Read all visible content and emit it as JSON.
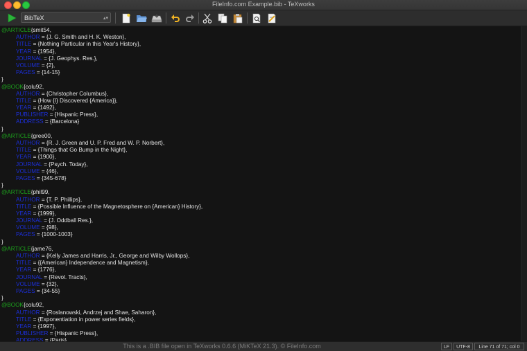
{
  "window": {
    "title": "FileInfo.com Example.bib - TeXworks"
  },
  "toolbar": {
    "engine": "BibTeX"
  },
  "statusbar": {
    "caption": "This is a .BIB file open in TeXworks 0.6.6 (MiKTeX 21.3). © FileInfo.com",
    "line_ending": "LF",
    "encoding": "UTF-8",
    "position": "Line 71 of 71; col 0"
  },
  "editor": {
    "lines": [
      {
        "t": "entry",
        "type": "@ARTICLE",
        "rest": "{smit54,"
      },
      {
        "t": "field",
        "key": "AUTHOR",
        "val": " = {J. G. Smith and H. K. Weston},"
      },
      {
        "t": "field",
        "key": "TITLE",
        "val": " = {Nothing Particular in this Year's History},"
      },
      {
        "t": "field",
        "key": "YEAR",
        "val": " = {1954},"
      },
      {
        "t": "field",
        "key": "JOURNAL",
        "val": " = {J. Geophys. Res.},"
      },
      {
        "t": "field",
        "key": "VOLUME",
        "val": " = {2},"
      },
      {
        "t": "field",
        "key": "PAGES",
        "val": " = {14-15}"
      },
      {
        "t": "close",
        "text": "}"
      },
      {
        "t": "entry",
        "type": "@BOOK",
        "rest": "{colu92,"
      },
      {
        "t": "field",
        "key": "AUTHOR",
        "val": " = {Christopher Columbus},"
      },
      {
        "t": "field",
        "key": "TITLE",
        "val": " = {How {I} Discovered {America}},"
      },
      {
        "t": "field",
        "key": "YEAR",
        "val": " = {1492},"
      },
      {
        "t": "field",
        "key": "PUBLISHER",
        "val": " = {Hispanic Press},"
      },
      {
        "t": "field",
        "key": "ADDRESS",
        "val": " = {Barcelona}"
      },
      {
        "t": "close",
        "text": "}"
      },
      {
        "t": "entry",
        "type": "@ARTICLE",
        "rest": "{gree00,"
      },
      {
        "t": "field",
        "key": "AUTHOR",
        "val": " = {R. J. Green and U. P. Fred and W. P. Norbert},"
      },
      {
        "t": "field",
        "key": "TITLE",
        "val": " = {Things that Go Bump in the Night},"
      },
      {
        "t": "field",
        "key": "YEAR",
        "val": " = {1900},"
      },
      {
        "t": "field",
        "key": "JOURNAL",
        "val": " = {Psych. Today},"
      },
      {
        "t": "field",
        "key": "VOLUME",
        "val": " = {46},"
      },
      {
        "t": "field",
        "key": "PAGES",
        "val": " = {345-678}"
      },
      {
        "t": "close",
        "text": "}"
      },
      {
        "t": "entry",
        "type": "@ARTICLE",
        "rest": "{phil99,"
      },
      {
        "t": "field",
        "key": "AUTHOR",
        "val": " = {T. P. Phillips},"
      },
      {
        "t": "field",
        "key": "TITLE",
        "val": " = {Possible Influence of the Magnetosphere on {American} History},"
      },
      {
        "t": "field",
        "key": "YEAR",
        "val": " = {1999},"
      },
      {
        "t": "field",
        "key": "JOURNAL",
        "val": " = {J. Oddball Res.},"
      },
      {
        "t": "field",
        "key": "VOLUME",
        "val": " = {98},"
      },
      {
        "t": "field",
        "key": "PAGES",
        "val": " = {1000-1003}"
      },
      {
        "t": "close",
        "text": "}"
      },
      {
        "t": "entry",
        "type": "@ARTICLE",
        "rest": "{jame76,"
      },
      {
        "t": "field",
        "key": "AUTHOR",
        "val": " = {Kelly James and Harris, Jr., George and Wilby Wollops},"
      },
      {
        "t": "field",
        "key": "TITLE",
        "val": " = {{American} Independence and Magnetism},"
      },
      {
        "t": "field",
        "key": "YEAR",
        "val": " = {1776},"
      },
      {
        "t": "field",
        "key": "JOURNAL",
        "val": " = {Revol. Tracts},"
      },
      {
        "t": "field",
        "key": "VOLUME",
        "val": " = {32},"
      },
      {
        "t": "field",
        "key": "PAGES",
        "val": " = {34-55}"
      },
      {
        "t": "close",
        "text": "}"
      },
      {
        "t": "entry",
        "type": "@BOOK",
        "rest": "{colu92,"
      },
      {
        "t": "field",
        "key": "AUTHOR",
        "val": " = {Roslanowski, Andrzej and Shae, Saharon},"
      },
      {
        "t": "field",
        "key": "TITLE",
        "val": " = {Exponentiation in power series fields},"
      },
      {
        "t": "field",
        "key": "YEAR",
        "val": " = {1997},"
      },
      {
        "t": "field",
        "key": "PUBLISHER",
        "val": " = {Hispanic Press},"
      },
      {
        "t": "field",
        "key": "ADDRESS",
        "val": " = {Paris}"
      }
    ]
  }
}
